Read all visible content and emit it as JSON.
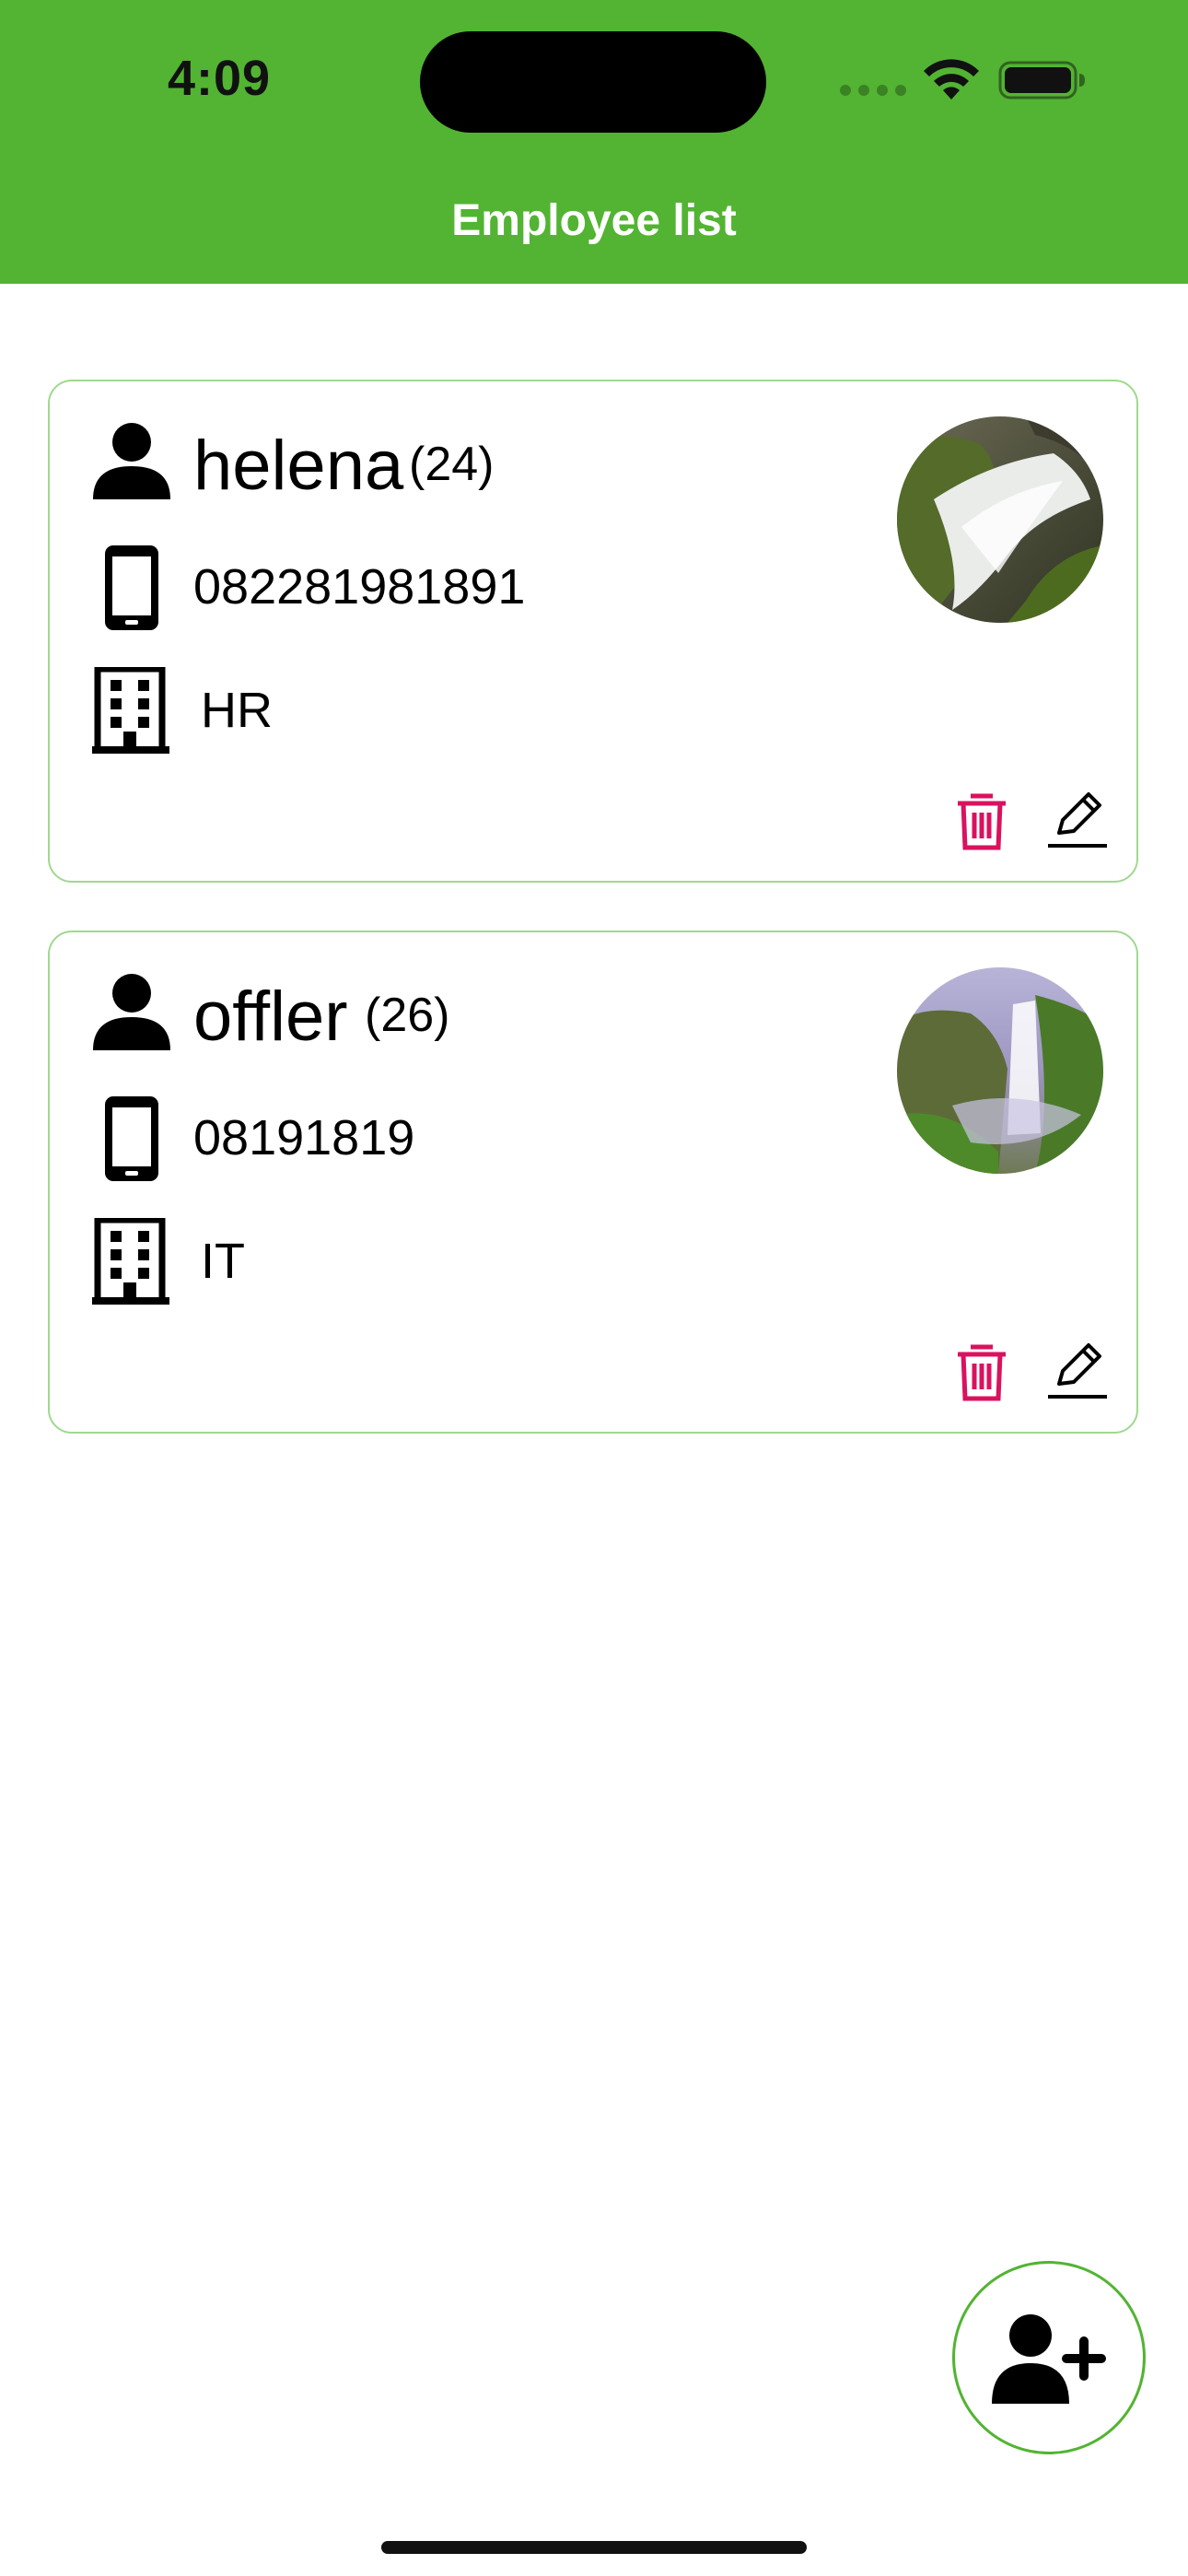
{
  "status_bar": {
    "time": "4:09"
  },
  "header": {
    "title": "Employee list",
    "background_color": "#52b432"
  },
  "employees": [
    {
      "name": "helena",
      "age_label": "(24)",
      "phone": "082281981891",
      "department": "HR",
      "photo": "waterfall-rocks-photo"
    },
    {
      "name": "offler",
      "age_label": "(26)",
      "phone": "08191819",
      "department": "IT",
      "photo": "waterfall-cliff-photo"
    }
  ],
  "colors": {
    "accent": "#52b432",
    "card_border": "#9fd98e",
    "delete_icon": "#d9125f"
  },
  "icons": {
    "name": "person-icon",
    "phone": "smartphone-icon",
    "department": "building-icon",
    "delete": "trash-icon",
    "edit": "pencil-icon",
    "add": "add-user-icon"
  }
}
